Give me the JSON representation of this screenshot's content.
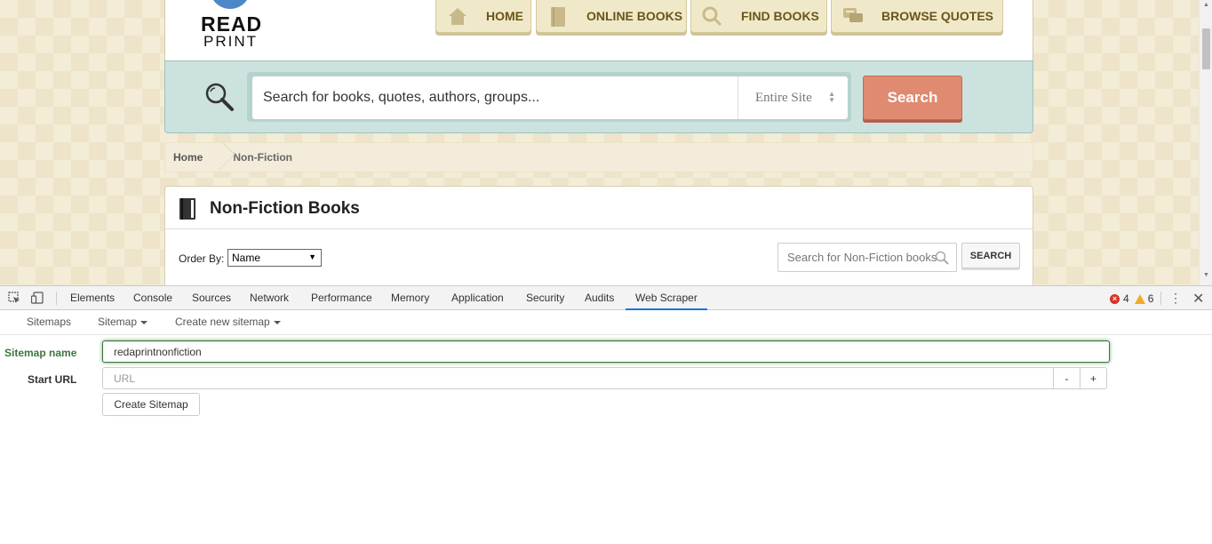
{
  "site": {
    "logo": {
      "line1": "READ",
      "line2": "PRINT"
    },
    "nav": [
      {
        "label": "HOME",
        "icon": "house-icon"
      },
      {
        "label": "ONLINE BOOKS",
        "icon": "book-icon"
      },
      {
        "label": "FIND BOOKS",
        "icon": "magnifier-icon"
      },
      {
        "label": "BROWSE QUOTES",
        "icon": "speech-bubbles-icon"
      }
    ],
    "search": {
      "placeholder": "Search for books, quotes, authors, groups...",
      "scope": "Entire Site",
      "button": "Search"
    },
    "breadcrumb": {
      "home": "Home",
      "current": "Non-Fiction"
    },
    "section": {
      "title": "Non-Fiction Books",
      "order_label": "Order By:",
      "order_value": "Name",
      "search_placeholder": "Search for Non-Fiction books",
      "search_button": "SEARCH"
    },
    "colors": {
      "accent_button": "#e08a72",
      "search_panel": "#cbe2df",
      "nav_text": "#6b5518"
    }
  },
  "devtools": {
    "tabs": [
      "Elements",
      "Console",
      "Sources",
      "Network",
      "Performance",
      "Memory",
      "Application",
      "Security",
      "Audits",
      "Web Scraper"
    ],
    "active_tab": "Web Scraper",
    "errors": "4",
    "warnings": "6",
    "ws_menu": {
      "sitemaps": "Sitemaps",
      "sitemap": "Sitemap",
      "create_new": "Create new sitemap"
    },
    "form": {
      "sitemap_name_label": "Sitemap name",
      "sitemap_name_value": "redaprintnonfiction",
      "start_url_label": "Start URL",
      "start_url_placeholder": "URL",
      "minus": "-",
      "plus": "+",
      "create_button": "Create Sitemap"
    },
    "colors": {
      "active_tab_underline": "#1a73e8",
      "valid_field": "#3c763d"
    }
  }
}
